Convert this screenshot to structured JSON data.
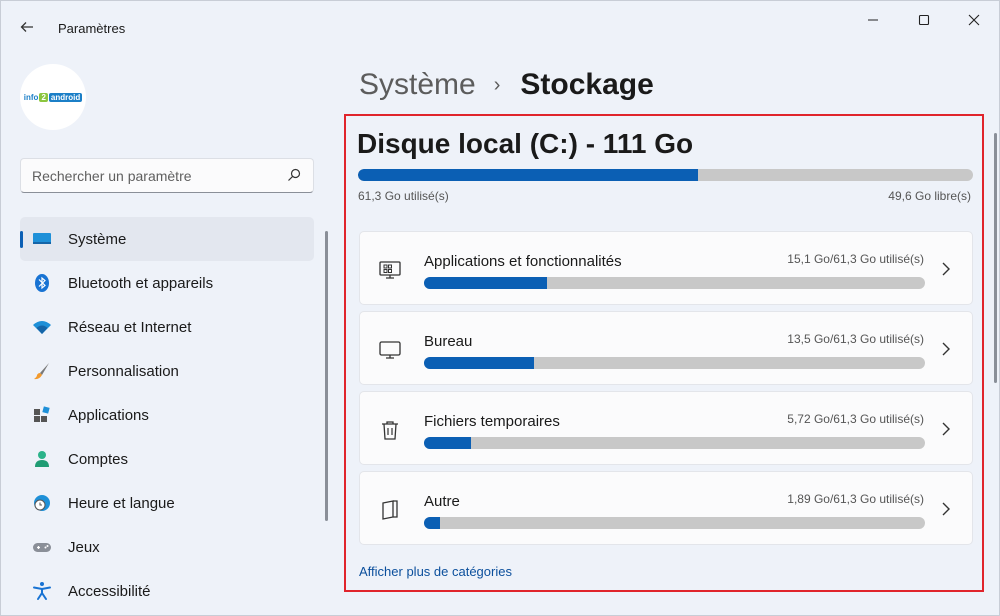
{
  "window": {
    "title": "Paramètres",
    "back_icon": "arrow-left-icon"
  },
  "sidebar": {
    "logo": {
      "part1": "info",
      "part2": "2",
      "part3": "android"
    },
    "search": {
      "placeholder": "Rechercher un paramètre",
      "value": ""
    },
    "items": [
      {
        "label": "Système",
        "icon": "monitor-icon",
        "active": true
      },
      {
        "label": "Bluetooth et appareils",
        "icon": "bluetooth-icon",
        "active": false
      },
      {
        "label": "Réseau et Internet",
        "icon": "wifi-icon",
        "active": false
      },
      {
        "label": "Personnalisation",
        "icon": "brush-icon",
        "active": false
      },
      {
        "label": "Applications",
        "icon": "apps-icon",
        "active": false
      },
      {
        "label": "Comptes",
        "icon": "person-icon",
        "active": false
      },
      {
        "label": "Heure et langue",
        "icon": "globe-clock-icon",
        "active": false
      },
      {
        "label": "Jeux",
        "icon": "gamepad-icon",
        "active": false
      },
      {
        "label": "Accessibilité",
        "icon": "accessibility-icon",
        "active": false
      }
    ]
  },
  "breadcrumb": {
    "parent": "Système",
    "separator": "›",
    "current": "Stockage"
  },
  "disk": {
    "title": "Disque local (C:) - 111 Go",
    "used_label": "61,3 Go utilisé(s)",
    "free_label": "49,6 Go libre(s)",
    "used_fraction": 0.553
  },
  "categories": [
    {
      "label": "Applications et fonctionnalités",
      "size": "15,1 Go/61,3 Go utilisé(s)",
      "fraction": 0.246,
      "icon": "apps-features-icon"
    },
    {
      "label": "Bureau",
      "size": "13,5 Go/61,3 Go utilisé(s)",
      "fraction": 0.22,
      "icon": "desktop-icon"
    },
    {
      "label": "Fichiers temporaires",
      "size": "5,72 Go/61,3 Go utilisé(s)",
      "fraction": 0.093,
      "icon": "trash-icon"
    },
    {
      "label": "Autre",
      "size": "1,89 Go/61,3 Go utilisé(s)",
      "fraction": 0.031,
      "icon": "document-icon"
    }
  ],
  "more_link": "Afficher plus de catégories",
  "colors": {
    "accent": "#0b5fb4",
    "highlight": "#e0242c",
    "track": "#c8c8c8"
  }
}
